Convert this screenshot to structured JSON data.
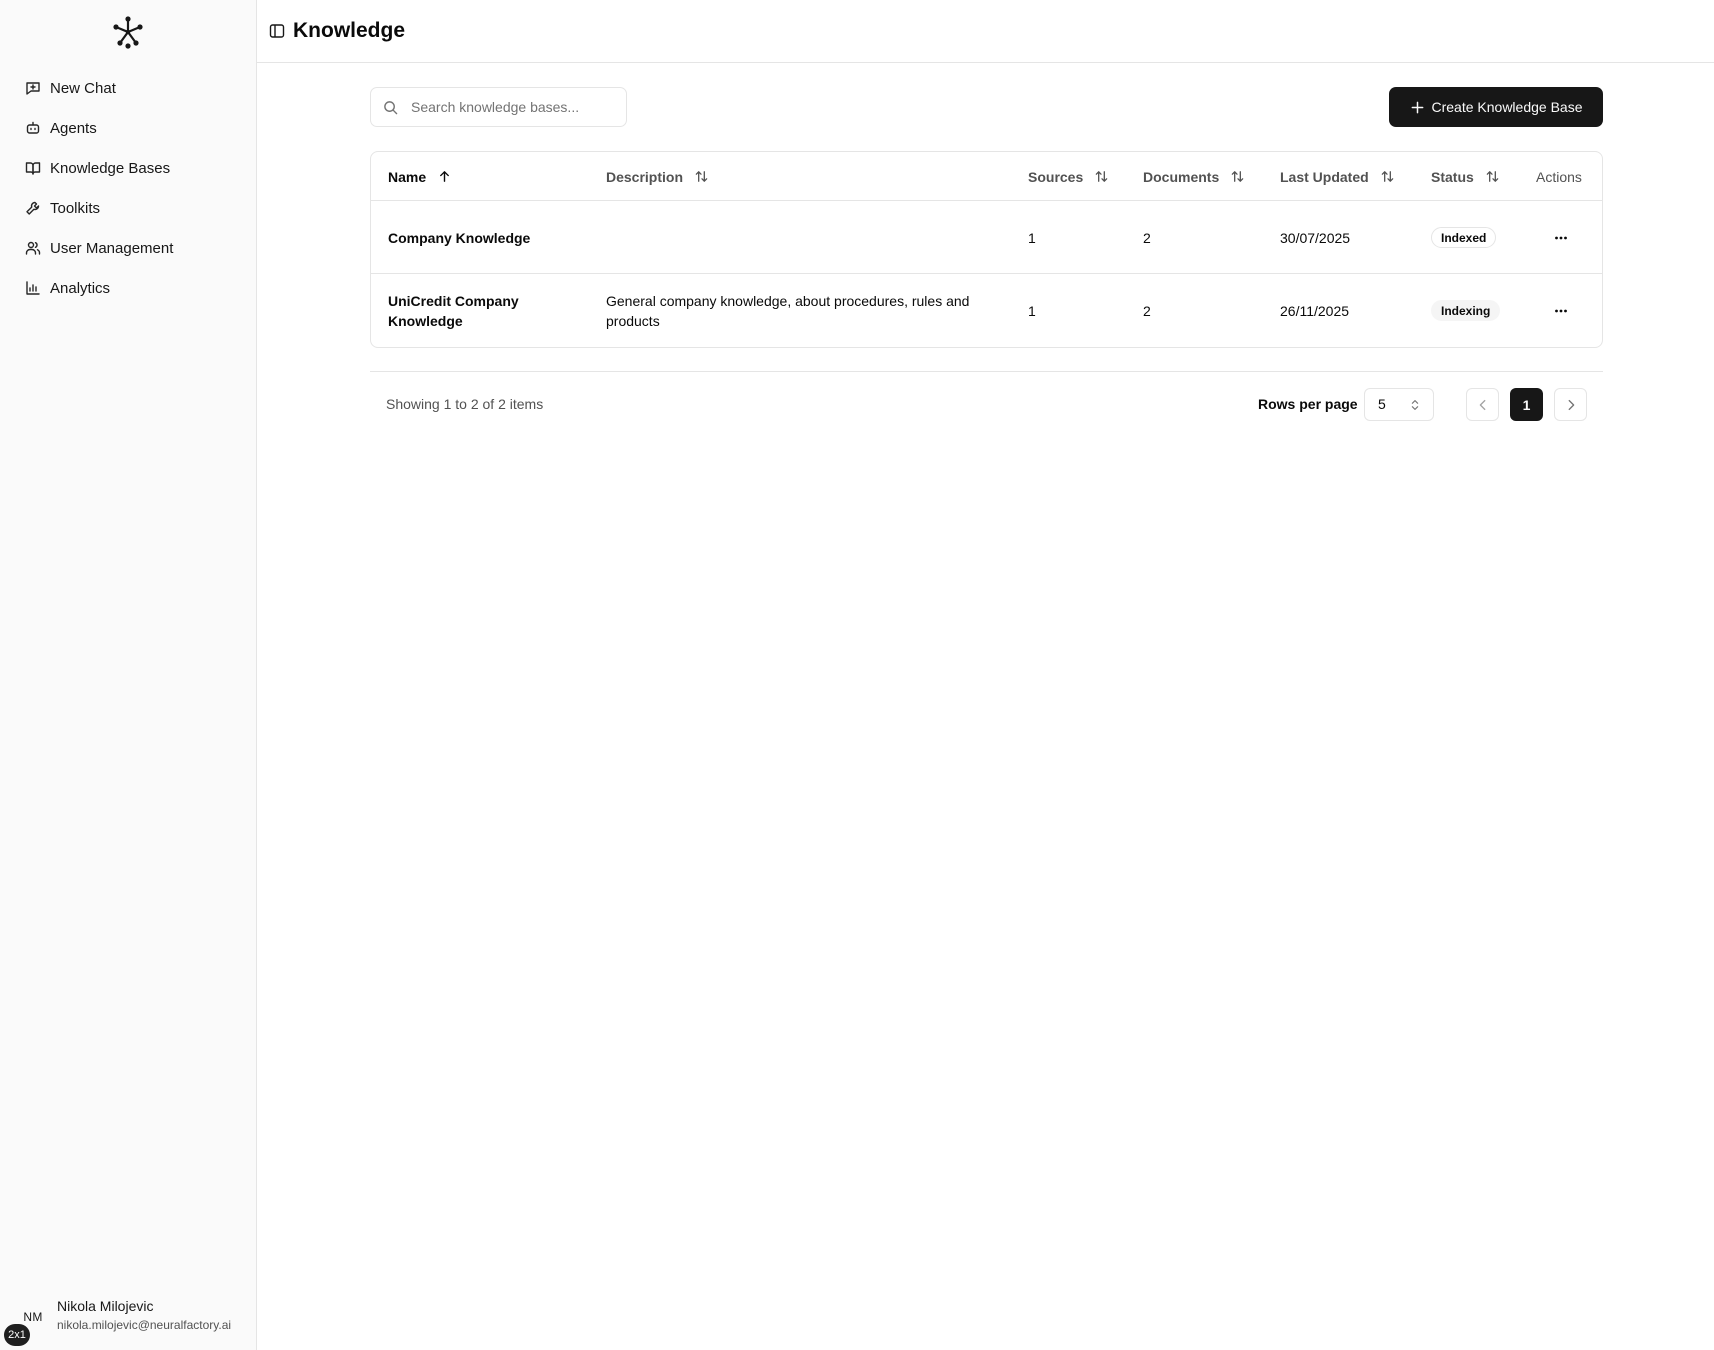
{
  "header": {
    "title": "Knowledge"
  },
  "sidebar": {
    "items": [
      {
        "label": "New Chat",
        "icon": "message-plus-icon"
      },
      {
        "label": "Agents",
        "icon": "bot-icon"
      },
      {
        "label": "Knowledge Bases",
        "icon": "book-open-icon"
      },
      {
        "label": "Toolkits",
        "icon": "wrench-icon"
      },
      {
        "label": "User Management",
        "icon": "users-icon"
      },
      {
        "label": "Analytics",
        "icon": "bar-chart-icon"
      }
    ],
    "user": {
      "initials": "NM",
      "name": "Nikola Milojevic",
      "email": "nikola.milojevic@neuralfactory.ai"
    },
    "corner_badge": "2x1"
  },
  "toolbar": {
    "search_placeholder": "Search knowledge bases...",
    "create_label": "Create Knowledge Base"
  },
  "table": {
    "columns": [
      {
        "label": "Name",
        "sort": "ascending"
      },
      {
        "label": "Description",
        "sort": "none"
      },
      {
        "label": "Sources",
        "sort": "none"
      },
      {
        "label": "Documents",
        "sort": "none"
      },
      {
        "label": "Last Updated",
        "sort": "none"
      },
      {
        "label": "Status",
        "sort": "none"
      },
      {
        "label": "Actions"
      }
    ],
    "rows": [
      {
        "name": "Company Knowledge",
        "description": "",
        "sources": "1",
        "documents": "2",
        "last_updated": "30/07/2025",
        "status": "Indexed"
      },
      {
        "name": "UniCredit Company Knowledge",
        "description": "General company knowledge, about procedures, rules and products",
        "sources": "1",
        "documents": "2",
        "last_updated": "26/11/2025",
        "status": "Indexing"
      }
    ]
  },
  "pagination": {
    "summary": "Showing 1 to 2 of 2 items",
    "rows_per_page_label": "Rows per page",
    "rows_per_page_value": "5",
    "current_page": "1"
  },
  "colors": {
    "primary": "#171717",
    "border": "#e5e5e5",
    "sidebar_bg": "#fafafa",
    "muted_text": "#525252"
  }
}
